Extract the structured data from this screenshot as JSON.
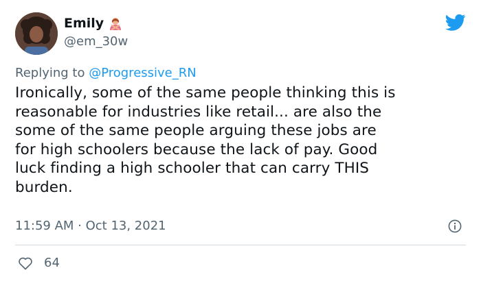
{
  "author": {
    "display_name": "Emily",
    "handle": "@em_30w",
    "name_emoji": "person-gesturing-no-emoji"
  },
  "reply": {
    "prefix": "Replying to ",
    "mention": "@Progressive_RN"
  },
  "tweet": {
    "text": "Ironically, some of the same people thinking this is\nreasonable for industries like retail... are also the\nsome of the same people arguing these jobs are\nfor high schoolers because the lack of pay. Good\nluck finding a high schooler that can carry THIS\nburden."
  },
  "meta": {
    "timestamp": "11:59 AM · Oct 13, 2021"
  },
  "actions": {
    "like_count": "64"
  },
  "icons": {
    "platform": "bird-logo-icon",
    "info": "info-icon",
    "like": "heart-icon"
  },
  "colors": {
    "brand_blue": "#1d9bf0",
    "text_primary": "#0f1419",
    "text_secondary": "#536471",
    "divider": "#cfd9de"
  }
}
